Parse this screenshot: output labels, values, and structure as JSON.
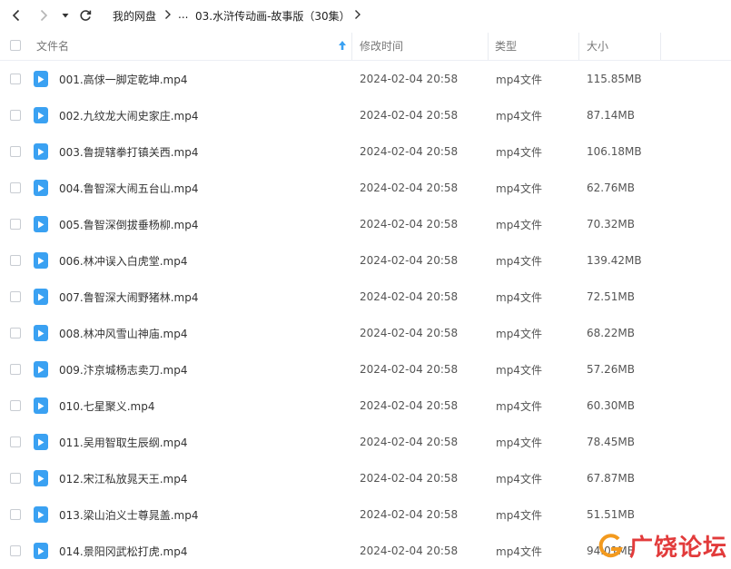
{
  "breadcrumb": {
    "root": "我的网盘",
    "ellipsis": "...",
    "current": "03.水浒传动画-故事版（30集）"
  },
  "columns": {
    "name": "文件名",
    "modified": "修改时间",
    "type": "类型",
    "size": "大小"
  },
  "sort": {
    "column": "name",
    "direction": "ascending",
    "icon": "arrow-up-icon"
  },
  "accent_color": "#3aa1f2",
  "files": [
    {
      "name": "001.高俅一脚定乾坤.mp4",
      "modified": "2024-02-04 20:58",
      "type": "mp4文件",
      "size": "115.85MB"
    },
    {
      "name": "002.九纹龙大闹史家庄.mp4",
      "modified": "2024-02-04 20:58",
      "type": "mp4文件",
      "size": "87.14MB"
    },
    {
      "name": "003.鲁提辖拳打镇关西.mp4",
      "modified": "2024-02-04 20:58",
      "type": "mp4文件",
      "size": "106.18MB"
    },
    {
      "name": "004.鲁智深大闹五台山.mp4",
      "modified": "2024-02-04 20:58",
      "type": "mp4文件",
      "size": "62.76MB"
    },
    {
      "name": "005.鲁智深倒拔垂杨柳.mp4",
      "modified": "2024-02-04 20:58",
      "type": "mp4文件",
      "size": "70.32MB"
    },
    {
      "name": "006.林冲误入白虎堂.mp4",
      "modified": "2024-02-04 20:58",
      "type": "mp4文件",
      "size": "139.42MB"
    },
    {
      "name": "007.鲁智深大闹野猪林.mp4",
      "modified": "2024-02-04 20:58",
      "type": "mp4文件",
      "size": "72.51MB"
    },
    {
      "name": "008.林冲风雪山神庙.mp4",
      "modified": "2024-02-04 20:58",
      "type": "mp4文件",
      "size": "68.22MB"
    },
    {
      "name": "009.汴京城杨志卖刀.mp4",
      "modified": "2024-02-04 20:58",
      "type": "mp4文件",
      "size": "57.26MB"
    },
    {
      "name": "010.七星聚义.mp4",
      "modified": "2024-02-04 20:58",
      "type": "mp4文件",
      "size": "60.30MB"
    },
    {
      "name": "011.吴用智取生辰纲.mp4",
      "modified": "2024-02-04 20:58",
      "type": "mp4文件",
      "size": "78.45MB"
    },
    {
      "name": "012.宋江私放晁天王.mp4",
      "modified": "2024-02-04 20:58",
      "type": "mp4文件",
      "size": "67.87MB"
    },
    {
      "name": "013.梁山泊义士尊晁盖.mp4",
      "modified": "2024-02-04 20:58",
      "type": "mp4文件",
      "size": "51.51MB"
    },
    {
      "name": "014.景阳冈武松打虎.mp4",
      "modified": "2024-02-04 20:58",
      "type": "mp4文件",
      "size": "94.01MB"
    }
  ],
  "watermark": {
    "text": "广饶论坛",
    "mark": "G"
  }
}
